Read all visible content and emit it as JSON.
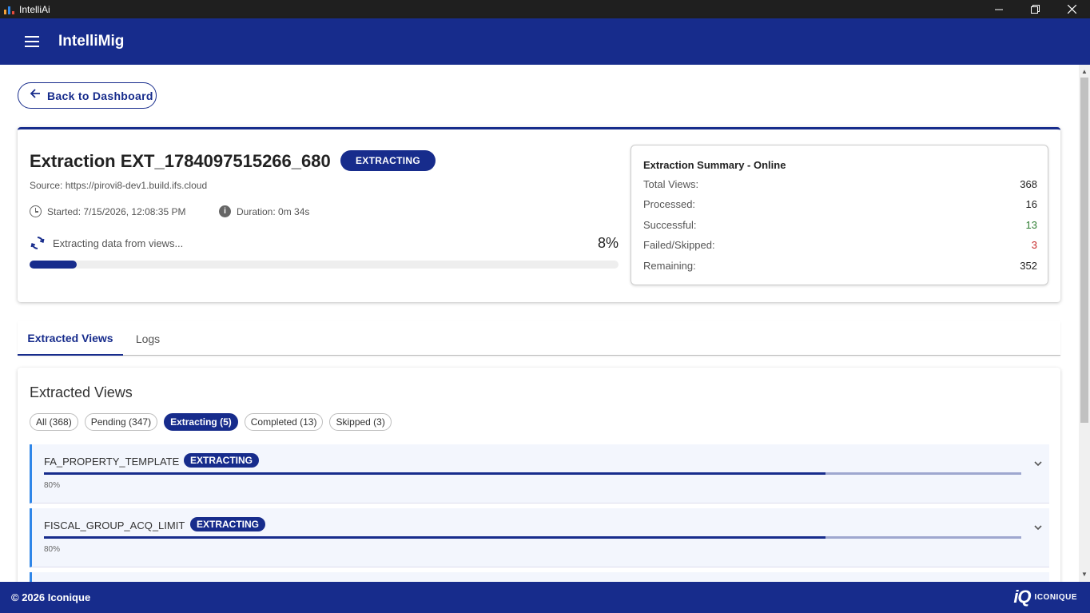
{
  "window": {
    "title": "IntelliAi"
  },
  "appbar": {
    "title": "IntelliMig"
  },
  "back_button": {
    "label": "Back to Dashboard"
  },
  "extraction": {
    "title": "Extraction EXT_1784097515266_680",
    "status": "EXTRACTING",
    "source": "Source: https://pirovi8-dev1.build.ifs.cloud",
    "started": "Started: 7/15/2026, 12:08:35 PM",
    "duration": "Duration: 0m 34s",
    "progress_label": "Extracting data from views...",
    "progress_text": "8%",
    "progress_fraction": 0.08
  },
  "summary": {
    "title": "Extraction Summary - Online",
    "rows": [
      {
        "label": "Total Views:",
        "value": "368",
        "color": "#222222"
      },
      {
        "label": "Processed:",
        "value": "16",
        "color": "#222222"
      },
      {
        "label": "Successful:",
        "value": "13",
        "color": "#2e7d32"
      },
      {
        "label": "Failed/Skipped:",
        "value": "3",
        "color": "#c62828"
      },
      {
        "label": "Remaining:",
        "value": "352",
        "color": "#222222"
      }
    ]
  },
  "tabs": [
    {
      "label": "Extracted Views",
      "active": true
    },
    {
      "label": "Logs",
      "active": false
    }
  ],
  "views": {
    "heading": "Extracted Views",
    "filters": [
      {
        "label": "All (368)",
        "active": false
      },
      {
        "label": "Pending (347)",
        "active": false
      },
      {
        "label": "Extracting (5)",
        "active": true
      },
      {
        "label": "Completed (13)",
        "active": false
      },
      {
        "label": "Skipped (3)",
        "active": false
      }
    ],
    "items": [
      {
        "name": "FA_PROPERTY_TEMPLATE",
        "status": "EXTRACTING",
        "progress_text": "80%",
        "progress_fraction": 0.8
      },
      {
        "name": "FISCAL_GROUP_ACQ_LIMIT",
        "status": "EXTRACTING",
        "progress_text": "80%",
        "progress_fraction": 0.8
      }
    ]
  },
  "footer": {
    "copyright": "© 2026 Iconique",
    "brand_mark": "iQ",
    "brand_name": "ICONIQUE"
  },
  "colors": {
    "primary": "#172c8c",
    "accent": "#2f86e8",
    "success": "#2e7d32",
    "error": "#c62828"
  },
  "icons": [
    "menu-icon",
    "arrow-left-icon",
    "clock-icon",
    "info-icon",
    "sync-icon",
    "chevron-down-icon",
    "minimize-icon",
    "restore-icon",
    "close-icon"
  ]
}
